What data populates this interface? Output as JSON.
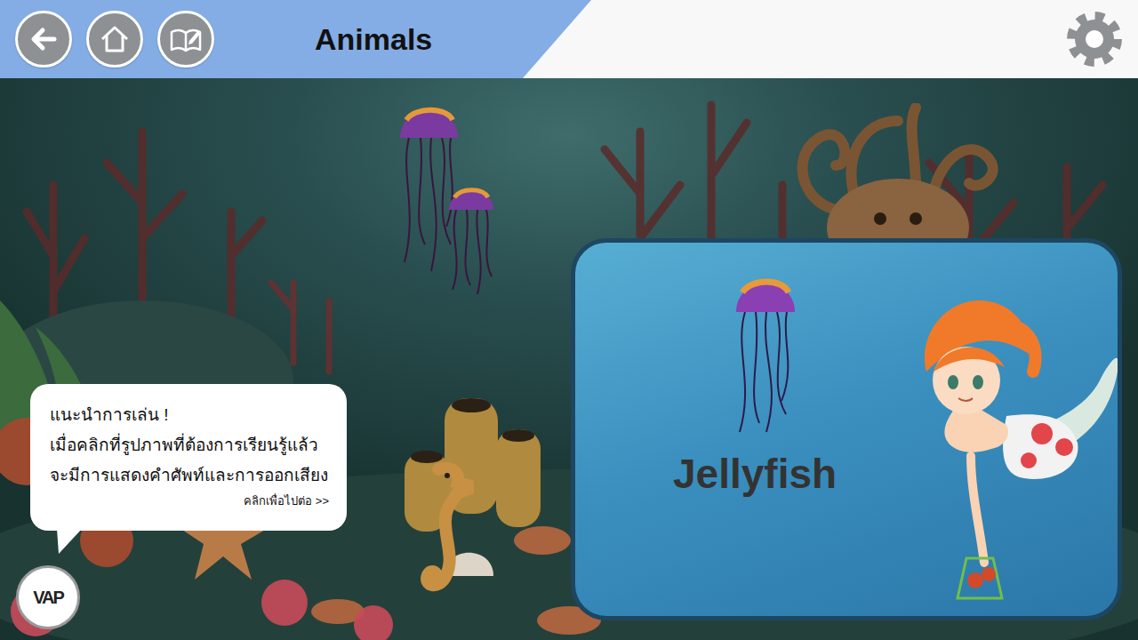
{
  "header": {
    "title": "Animals"
  },
  "word_card": {
    "word": "Jellyfish"
  },
  "hint": {
    "title": "แนะนำการเล่น !",
    "lines": [
      "เมื่อคลิกที่รูปภาพที่ต้องการเรียนรู้แล้ว",
      "จะมีการแสดงคำศัพท์และการออกเสียง"
    ],
    "next": "คลิกเพื่อไปต่อ >>"
  },
  "logo": {
    "text": "VAP"
  }
}
